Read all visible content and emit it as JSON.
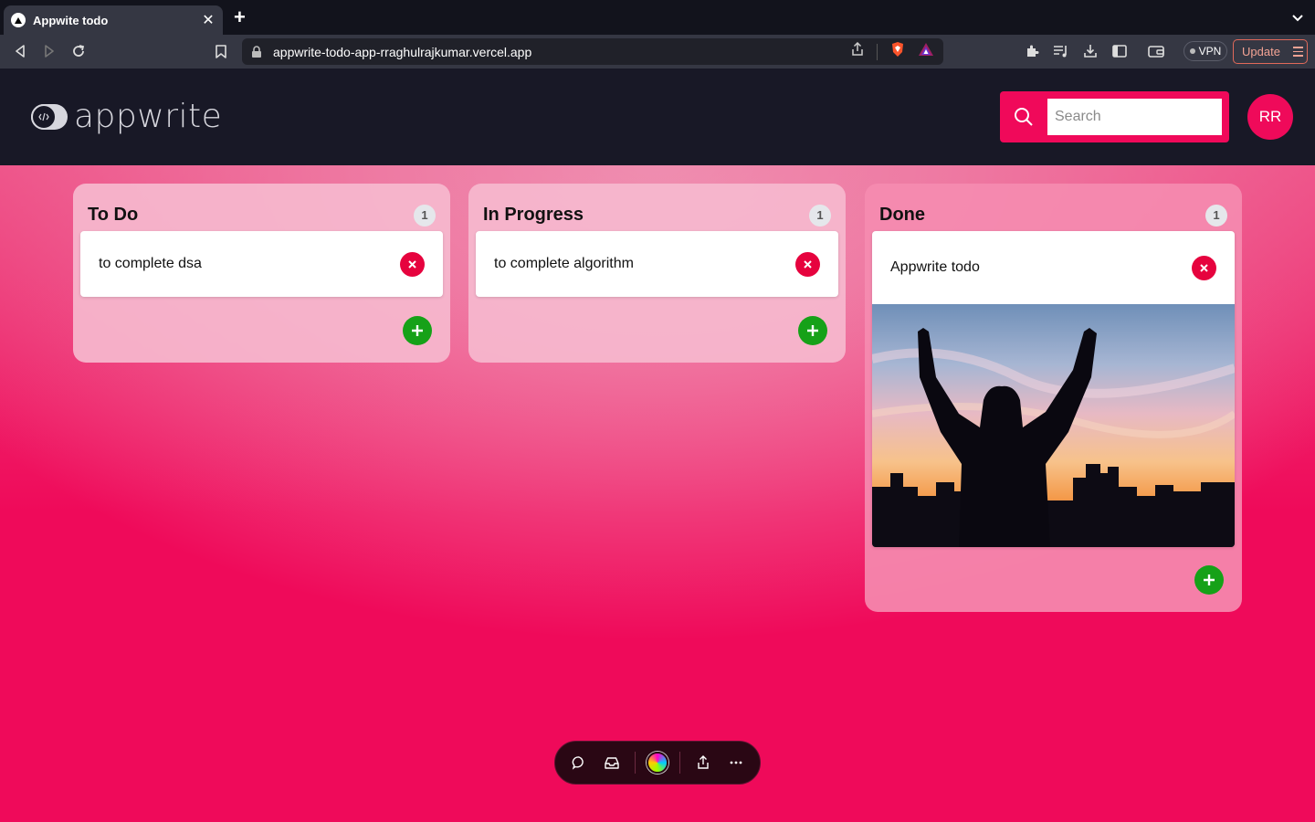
{
  "browser": {
    "tab_title": "Appwite todo",
    "tab_close": "✕",
    "new_tab": "+",
    "url": "appwrite-todo-app-rraghulrajkumar.vercel.app",
    "vpn_label": "VPN",
    "update_label": "Update"
  },
  "header": {
    "logo_text": "appwrite",
    "search_placeholder": "Search",
    "search_value": "",
    "avatar_initials": "RR"
  },
  "columns": [
    {
      "title": "To Do",
      "count": "1",
      "cards": [
        {
          "text": "to complete dsa",
          "has_image": false
        }
      ]
    },
    {
      "title": "In Progress",
      "count": "1",
      "cards": [
        {
          "text": "to complete algorithm",
          "has_image": false
        }
      ]
    },
    {
      "title": "Done",
      "count": "1",
      "cards": [
        {
          "text": "Appwrite todo",
          "has_image": true
        }
      ]
    }
  ],
  "icons": {
    "delete": "x-icon",
    "add": "plus-icon"
  },
  "colors": {
    "brand_pink": "#ef0a5a",
    "header_bg": "#181826",
    "delete_red": "#e6033e",
    "add_green": "#16a118"
  }
}
